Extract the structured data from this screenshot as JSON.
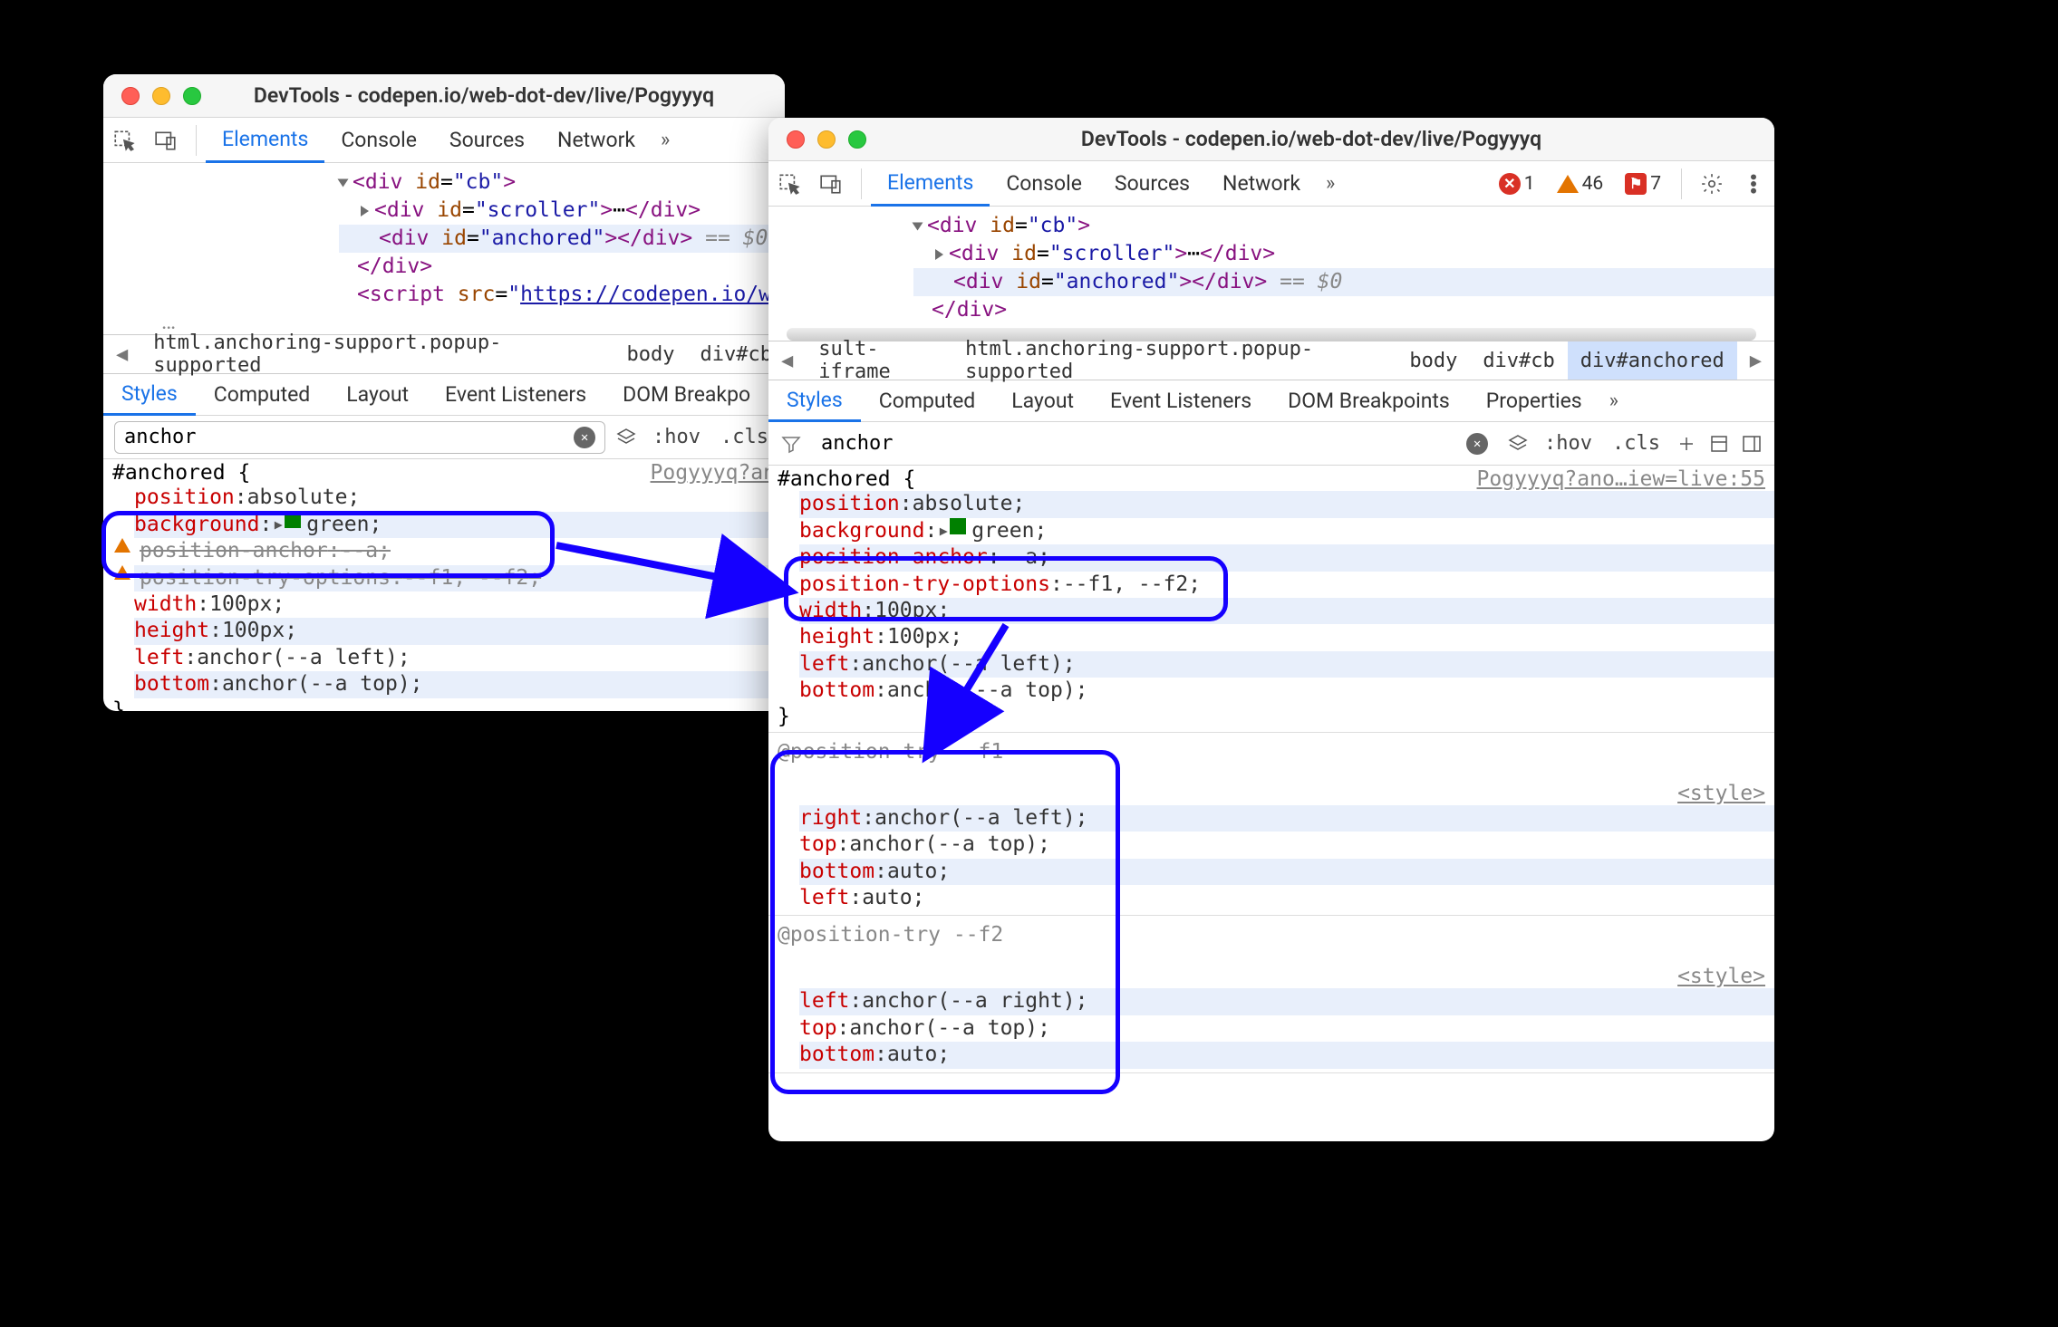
{
  "page_background": "#000000",
  "accent_color": "#1a73e8",
  "highlight_color": "#1500ff",
  "windows": {
    "left": {
      "title": "DevTools - codepen.io/web-dot-dev/live/Pogyyyq",
      "tabs": {
        "elements": "Elements",
        "console": "Console",
        "sources": "Sources",
        "network": "Network",
        "active": "Elements"
      },
      "dom": {
        "line1": {
          "tag": "div",
          "id": "cb"
        },
        "line2": {
          "tag": "div",
          "id": "scroller",
          "ellipsis": "…"
        },
        "line3": {
          "tag": "div",
          "id": "anchored",
          "eq": "== $0"
        },
        "line4": "</div>",
        "script_src": "https://codepen.io/web-dot-d"
      },
      "crumbs": [
        "html.anchoring-support.popup-supported",
        "body",
        "div#cb"
      ],
      "subtabs": {
        "styles": "Styles",
        "computed": "Computed",
        "layout": "Layout",
        "eventlisteners": "Event Listeners",
        "dombp": "DOM Breakpo",
        "active": "Styles"
      },
      "filter": {
        "value": "anchor",
        "hov": ":hov",
        "cls": ".cls"
      },
      "style_hdr": {
        "selector": "#anchored {",
        "source": "Pogyyyq?an"
      },
      "decls": [
        {
          "prop": "position",
          "val": "absolute",
          "alt": false
        },
        {
          "prop": "background",
          "val": "green",
          "alt": true,
          "swatch": "green",
          "caret": true
        },
        {
          "prop": "position-anchor",
          "val": "--a",
          "alt": false,
          "warn": true,
          "strike": true
        },
        {
          "prop": "position-try-options",
          "val": "--f1, --f2",
          "alt": true,
          "warn": true,
          "strike": true
        },
        {
          "prop": "width",
          "val": "100px",
          "alt": false
        },
        {
          "prop": "height",
          "val": "100px",
          "alt": true
        },
        {
          "prop": "left",
          "val": "anchor(--a left)",
          "alt": false
        },
        {
          "prop": "bottom",
          "val": "anchor(--a top)",
          "alt": true
        }
      ],
      "close": "}"
    },
    "right": {
      "title": "DevTools - codepen.io/web-dot-dev/live/Pogyyyq",
      "tabs": {
        "elements": "Elements",
        "console": "Console",
        "sources": "Sources",
        "network": "Network",
        "active": "Elements"
      },
      "status": {
        "errors": "1",
        "warnings": "46",
        "info": "7"
      },
      "dom": {
        "line1": {
          "tag": "div",
          "id": "cb"
        },
        "line2": {
          "tag": "div",
          "id": "scroller",
          "ellipsis": "…"
        },
        "line3": {
          "tag": "div",
          "id": "anchored",
          "eq": "== $0"
        },
        "line4": "</div>"
      },
      "crumbs": [
        "sult-iframe",
        "html.anchoring-support.popup-supported",
        "body",
        "div#cb",
        "div#anchored"
      ],
      "crumb_selected": 4,
      "subtabs": {
        "styles": "Styles",
        "computed": "Computed",
        "layout": "Layout",
        "eventlisteners": "Event Listeners",
        "dombp": "DOM Breakpoints",
        "properties": "Properties",
        "active": "Styles"
      },
      "filter": {
        "value": "anchor",
        "hov": ":hov",
        "cls": ".cls"
      },
      "style_hdr": {
        "selector": "#anchored {",
        "source": "Pogyyyq?ano…iew=live:55"
      },
      "decls": [
        {
          "prop": "position",
          "val": "absolute",
          "alt": true
        },
        {
          "prop": "background",
          "val": "green",
          "alt": false,
          "swatch": "green",
          "caret": true
        },
        {
          "prop": "position-anchor",
          "val": "--a",
          "alt": true
        },
        {
          "prop": "position-try-options",
          "val": "--f1, --f2",
          "alt": false
        },
        {
          "prop": "width",
          "val": "100px",
          "alt": true
        },
        {
          "prop": "height",
          "val": "100px",
          "alt": false
        },
        {
          "prop": "left",
          "val": "anchor(--a left)",
          "alt": true
        },
        {
          "prop": "bottom",
          "val": "anchor(--a top)",
          "alt": false
        }
      ],
      "close": "}",
      "position_try": [
        {
          "header": "@position-try --f1",
          "style_link": "<style>",
          "decls": [
            {
              "prop": "right",
              "val": "anchor(--a left)",
              "alt": true
            },
            {
              "prop": "top",
              "val": "anchor(--a top)",
              "alt": false
            },
            {
              "prop": "bottom",
              "val": "auto",
              "alt": true
            },
            {
              "prop": "left",
              "val": "auto",
              "alt": false
            }
          ]
        },
        {
          "header": "@position-try --f2",
          "style_link": "<style>",
          "decls": [
            {
              "prop": "left",
              "val": "anchor(--a right)",
              "alt": true
            },
            {
              "prop": "top",
              "val": "anchor(--a top)",
              "alt": false
            },
            {
              "prop": "bottom",
              "val": "auto",
              "alt": true
            }
          ]
        }
      ]
    }
  }
}
